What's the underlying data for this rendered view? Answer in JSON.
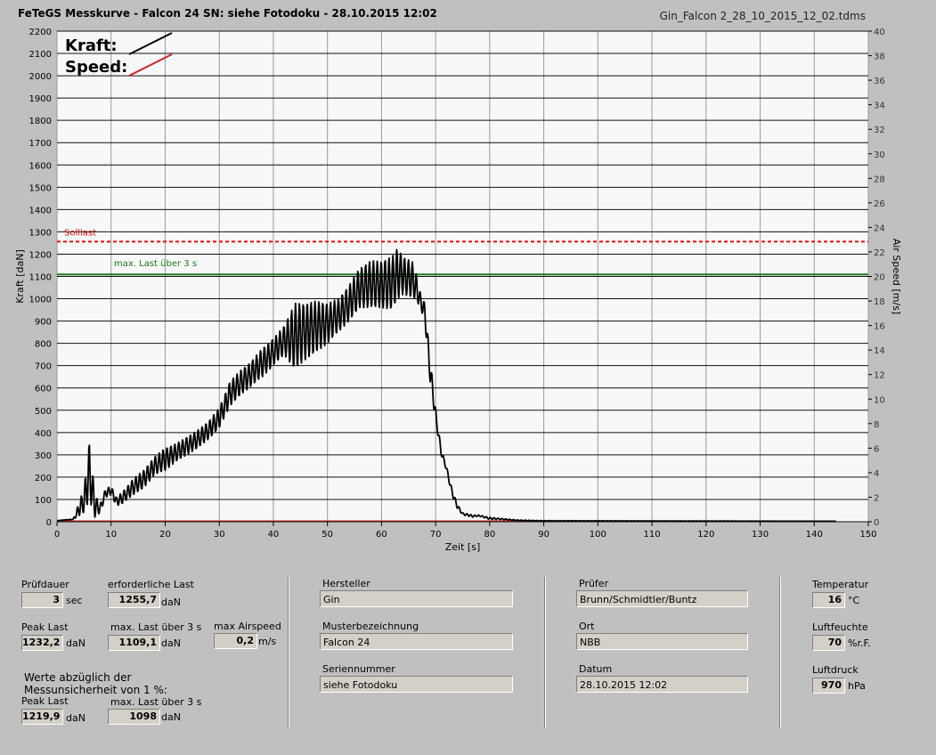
{
  "header": {
    "title": "FeTeGS Messkurve - Falcon 24  SN: siehe Fotodoku - 28.10.2015 12:02",
    "filename": "Gin_Falcon 2_28_10_2015_12_02.tdms"
  },
  "legend": {
    "kraft": "Kraft:",
    "speed": "Speed:"
  },
  "annotations": {
    "solllast": "Solllast",
    "max_last": "max. Last über  3 s"
  },
  "colors": {
    "kraft": "#000000",
    "speed": "#cc2222",
    "solllast": "#dd1111",
    "max_last": "#1a7a1a",
    "plot_bg": "#f8f8f8",
    "panel_bg": "#c0c0c0"
  },
  "chart_data": {
    "type": "line",
    "xlabel": "Zeit [s]",
    "ylabel": "Kraft [daN]",
    "y2label": "Air Speed [m/s]",
    "xlim": [
      0,
      150
    ],
    "ylim": [
      0,
      2200
    ],
    "y2lim": [
      0,
      40
    ],
    "x_ticks": [
      0,
      10,
      20,
      30,
      40,
      50,
      60,
      70,
      80,
      90,
      100,
      110,
      120,
      130,
      140,
      150
    ],
    "y_ticks": [
      0,
      100,
      200,
      300,
      400,
      500,
      600,
      700,
      800,
      900,
      1000,
      1100,
      1200,
      1300,
      1400,
      1500,
      1600,
      1700,
      1800,
      1900,
      2000,
      2100,
      2200
    ],
    "y2_ticks": [
      0,
      2,
      4,
      6,
      8,
      10,
      12,
      14,
      16,
      18,
      20,
      22,
      24,
      26,
      28,
      30,
      32,
      34,
      36,
      38,
      40
    ],
    "grid": true,
    "hlines": [
      {
        "name": "Solllast",
        "y": 1256,
        "style": "dashed"
      },
      {
        "name": "max. Last über  3 s",
        "y": 1109,
        "style": "solid"
      }
    ],
    "series": [
      {
        "name": "Kraft",
        "envelope": [
          [
            0,
            5,
            5
          ],
          [
            3,
            10,
            12
          ],
          [
            5,
            40,
            150
          ],
          [
            6,
            100,
            360
          ],
          [
            7,
            20,
            120
          ],
          [
            8,
            40,
            80
          ],
          [
            9,
            110,
            150
          ],
          [
            10,
            120,
            160
          ],
          [
            11,
            70,
            110
          ],
          [
            12,
            80,
            130
          ],
          [
            14,
            120,
            190
          ],
          [
            16,
            150,
            230
          ],
          [
            18,
            210,
            290
          ],
          [
            20,
            230,
            330
          ],
          [
            22,
            270,
            350
          ],
          [
            24,
            300,
            380
          ],
          [
            26,
            330,
            410
          ],
          [
            28,
            370,
            450
          ],
          [
            30,
            420,
            510
          ],
          [
            32,
            520,
            630
          ],
          [
            34,
            570,
            680
          ],
          [
            36,
            610,
            720
          ],
          [
            38,
            650,
            780
          ],
          [
            40,
            700,
            820
          ],
          [
            42,
            750,
            880
          ],
          [
            44,
            680,
            980
          ],
          [
            46,
            730,
            980
          ],
          [
            48,
            760,
            990
          ],
          [
            50,
            800,
            980
          ],
          [
            52,
            850,
            1000
          ],
          [
            54,
            900,
            1060
          ],
          [
            56,
            960,
            1140
          ],
          [
            58,
            960,
            1170
          ],
          [
            60,
            960,
            1170
          ],
          [
            62,
            950,
            1190
          ],
          [
            63,
            1000,
            1230
          ],
          [
            64,
            1020,
            1190
          ],
          [
            66,
            1000,
            1160
          ],
          [
            67,
            970,
            1040
          ],
          [
            68,
            900,
            980
          ],
          [
            69,
            620,
            730
          ],
          [
            70,
            450,
            510
          ],
          [
            71,
            300,
            330
          ],
          [
            72,
            230,
            250
          ],
          [
            73,
            120,
            150
          ],
          [
            74,
            60,
            80
          ],
          [
            75,
            30,
            40
          ],
          [
            77,
            20,
            30
          ],
          [
            78,
            25,
            30
          ],
          [
            80,
            10,
            20
          ],
          [
            82,
            10,
            15
          ],
          [
            85,
            5,
            8
          ],
          [
            90,
            3,
            5
          ],
          [
            144,
            2,
            2
          ]
        ]
      },
      {
        "name": "Speed",
        "values": [
          [
            0,
            0
          ],
          [
            144,
            0
          ]
        ]
      }
    ]
  },
  "results": {
    "pruefdauer_label": "Prüfdauer",
    "pruefdauer_value": "3",
    "pruefdauer_unit": "sec",
    "erf_label": "erforderliche Last",
    "erf_value": "1255,7",
    "erf_unit": "daN",
    "peak_label": "Peak Last",
    "peak_value": "1232,2",
    "peak_unit": "daN",
    "maxlast_label": "max. Last über  3 s",
    "maxlast_value": "1109,1",
    "maxlast_unit": "daN",
    "airspeed_label": "max Airspeed",
    "airspeed_value": "0,2",
    "airspeed_unit": "m/s",
    "werte_line1": "Werte abzüglich der",
    "werte_line2": "Messunsicherheit von 1  %:",
    "peak2_label": "Peak Last",
    "peak2_value": "1219,9",
    "peak2_unit": "daN",
    "maxlast2_label": "max. Last über  3 s",
    "maxlast2_value": "1098",
    "maxlast2_unit": "daN"
  },
  "info": {
    "hersteller_label": "Hersteller",
    "hersteller_value": "Gin",
    "muster_label": "Musterbezeichnung",
    "muster_value": "Falcon 24",
    "serien_label": "Seriennummer",
    "serien_value": "siehe Fotodoku",
    "pruefer_label": "Prüfer",
    "pruefer_value": "Brunn/Schmidtler/Buntz",
    "ort_label": "Ort",
    "ort_value": "NBB",
    "datum_label": "Datum",
    "datum_value": "28.10.2015 12:02"
  },
  "env": {
    "temp_label": "Temperatur",
    "temp_value": "16",
    "temp_unit": "°C",
    "feuchte_label": "Luftfeuchte",
    "feuchte_value": "70",
    "feuchte_unit": "%r.F.",
    "druck_label": "Luftdruck",
    "druck_value": "970",
    "druck_unit": "hPa"
  }
}
